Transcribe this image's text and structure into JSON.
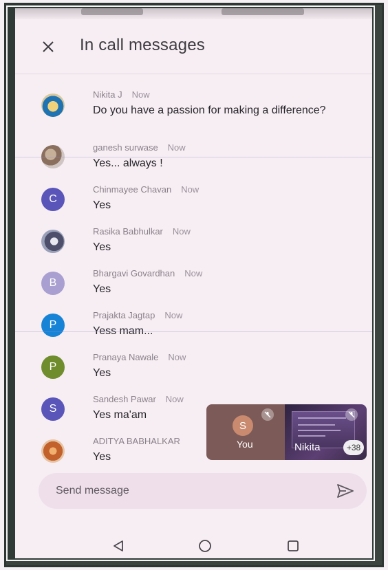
{
  "header": {
    "title": "In call messages",
    "close_icon": "close-icon"
  },
  "messages": [
    {
      "sender": "Nikita J",
      "time": "Now",
      "text": "Do you have a passion for making a difference?",
      "avatar": "photo"
    },
    {
      "sender": "ganesh surwase",
      "time": "Now",
      "text": "Yes... always !",
      "avatar": "photo"
    },
    {
      "sender": "Chinmayee Chavan",
      "time": "Now",
      "text": "Yes",
      "avatar": "C",
      "color": "#5a55b8"
    },
    {
      "sender": "Rasika Babhulkar",
      "time": "Now",
      "text": "Yes",
      "avatar": "photo"
    },
    {
      "sender": "Bhargavi Govardhan",
      "time": "Now",
      "text": "Yes",
      "avatar": "B",
      "color": "#a99fd0"
    },
    {
      "sender": "Prajakta Jagtap",
      "time": "Now",
      "text": "Yess mam...",
      "avatar": "P",
      "color": "#1783d6"
    },
    {
      "sender": "Pranaya Nawale",
      "time": "Now",
      "text": "Yes",
      "avatar": "P",
      "color": "#6f8d2c"
    },
    {
      "sender": "Sandesh Pawar",
      "time": "Now",
      "text": "Yes ma'am",
      "avatar": "S",
      "color": "#5a55b8"
    },
    {
      "sender": "ADITYA BABHALKAR",
      "time": "",
      "text": "Yes",
      "avatar": "photo"
    }
  ],
  "tiles": {
    "you": {
      "initial": "S",
      "label": "You"
    },
    "nikita": {
      "label": "Nikita",
      "more_count": "+38"
    }
  },
  "composer": {
    "placeholder": "Send message",
    "send_icon": "send-icon"
  },
  "navbar": {
    "back_icon": "back-triangle-icon",
    "home_icon": "home-circle-icon",
    "recents_icon": "recents-square-icon"
  }
}
